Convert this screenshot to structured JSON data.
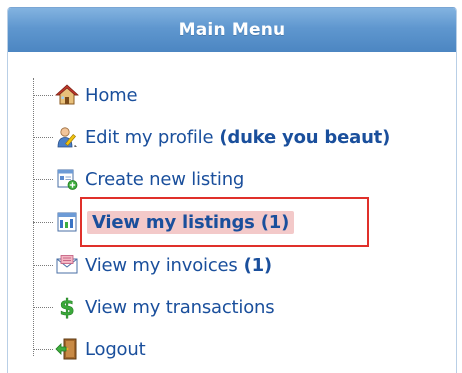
{
  "header": {
    "title": "Main Menu"
  },
  "menu": {
    "home": {
      "label": "Home",
      "icon": "home-icon"
    },
    "edit_profile": {
      "label": "Edit my profile",
      "extra": "(duke you beaut)",
      "icon": "user-edit-icon"
    },
    "create_listing": {
      "label": "Create new listing",
      "icon": "add-listing-icon"
    },
    "view_listings": {
      "label": "View my listings (1)",
      "icon": "listings-icon",
      "active": true
    },
    "view_invoices": {
      "label": "View my invoices",
      "extra": "(1)",
      "icon": "envelope-icon"
    },
    "view_transactions": {
      "label": "View my transactions",
      "icon": "dollar-icon"
    },
    "logout": {
      "label": "Logout",
      "icon": "logout-door-icon"
    }
  },
  "colors": {
    "header_top": "#83b3e0",
    "header_bottom": "#4c86c2",
    "link": "#1a4f9c",
    "active_bg": "#f3c9c9",
    "highlight_border": "#e0302a"
  }
}
